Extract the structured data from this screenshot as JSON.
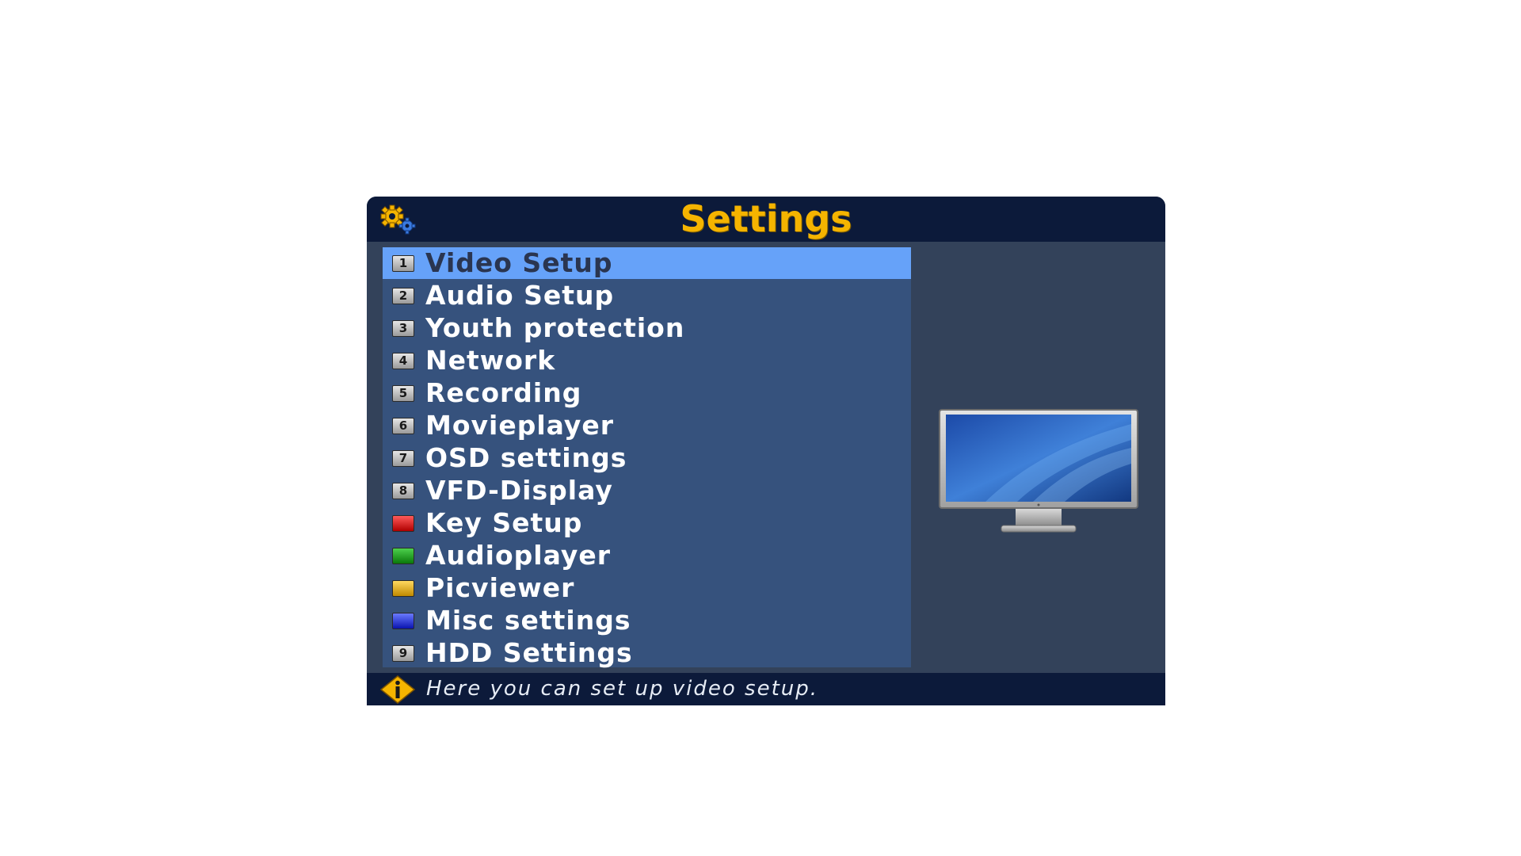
{
  "header": {
    "title": "Settings",
    "icon": "gears-icon"
  },
  "menu": {
    "selected_index": 0,
    "items": [
      {
        "key": "1",
        "key_type": "number",
        "label": "Video Setup"
      },
      {
        "key": "2",
        "key_type": "number",
        "label": "Audio Setup"
      },
      {
        "key": "3",
        "key_type": "number",
        "label": "Youth protection"
      },
      {
        "key": "4",
        "key_type": "number",
        "label": "Network"
      },
      {
        "key": "5",
        "key_type": "number",
        "label": "Recording"
      },
      {
        "key": "6",
        "key_type": "number",
        "label": "Movieplayer"
      },
      {
        "key": "7",
        "key_type": "number",
        "label": "OSD settings"
      },
      {
        "key": "8",
        "key_type": "number",
        "label": "VFD-Display"
      },
      {
        "key": "",
        "key_type": "red",
        "label": "Key Setup"
      },
      {
        "key": "",
        "key_type": "green",
        "label": "Audioplayer"
      },
      {
        "key": "",
        "key_type": "yellow",
        "label": "Picviewer"
      },
      {
        "key": "",
        "key_type": "blue",
        "label": "Misc settings"
      },
      {
        "key": "9",
        "key_type": "number",
        "label": "HDD Settings"
      }
    ]
  },
  "preview": {
    "icon": "monitor-icon"
  },
  "footer": {
    "icon": "info-icon",
    "hint": "Here you can set up video setup."
  },
  "colors": {
    "title": "#f5b400",
    "header_bg": "#0c1a3a",
    "panel_bg": "#33425a",
    "menu_bg": "#36527d",
    "selected_bg": "#66a2f9",
    "key_red": "#d01818",
    "key_green": "#18a018",
    "key_yellow": "#e0b020",
    "key_blue": "#2030d8"
  }
}
